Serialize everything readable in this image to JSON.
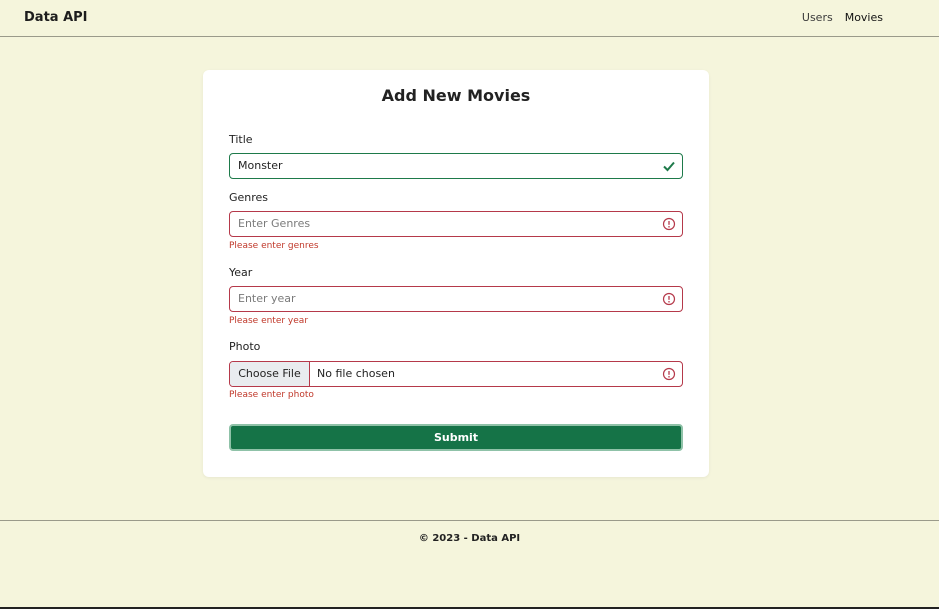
{
  "navbar": {
    "brand": "Data API",
    "links": [
      {
        "label": "Users"
      },
      {
        "label": "Movies"
      }
    ]
  },
  "form": {
    "title": "Add New Movies",
    "fields": {
      "title": {
        "label": "Title",
        "value": "Monster",
        "status": "valid",
        "icon": "checkmark-icon"
      },
      "genres": {
        "label": "Genres",
        "placeholder": "Enter Genres",
        "error": "Please enter genres",
        "icon": "error-circle-icon"
      },
      "year": {
        "label": "Year",
        "placeholder": "Enter year",
        "error": "Please enter year",
        "icon": "error-circle-icon"
      },
      "photo": {
        "label": "Photo",
        "button": "Choose File",
        "file_status": "No file chosen",
        "error": "Please enter photo",
        "icon": "error-circle-icon"
      }
    },
    "submit_label": "Submit"
  },
  "footer": {
    "text": "© 2023 - Data API"
  },
  "colors": {
    "background": "#f5f5dc",
    "valid": "#1e7a4a",
    "invalid": "#b5394a",
    "error_text": "#c0392b",
    "submit": "#157347"
  }
}
